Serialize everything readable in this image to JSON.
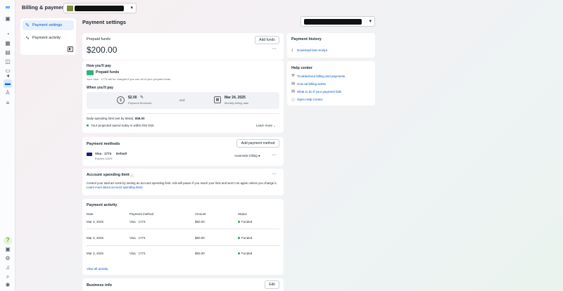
{
  "app": {
    "title": "Billing & payments"
  },
  "rail_icons": [
    "meta-logo-icon",
    "account-icon",
    "dashboard-icon",
    "table-icon",
    "doc-icon",
    "campaign-icon",
    "megaphone-icon",
    "billing-icon",
    "people-icon",
    "menu-icon",
    "help-icon",
    "feedback-icon",
    "settings-icon",
    "notifications-icon",
    "search-icon",
    "bug-icon"
  ],
  "subnav": {
    "items": [
      {
        "label": "Payment settings"
      },
      {
        "label": "Payment activity"
      }
    ]
  },
  "page": {
    "title": "Payment settings"
  },
  "prepaid": {
    "title": "Prepaid funds",
    "amount": "$200.00",
    "add_funds": "Add funds",
    "how_pay_heading": "How you'll pay",
    "method_name": "Prepaid funds",
    "method_note": "Your Visa · 1774 will be charged if you use all of your prepaid funds.",
    "when_pay_heading": "When you'll pay",
    "threshold_value": "$2.00",
    "threshold_label": "Payment threshold",
    "and_text": "and",
    "billing_date": "Mar 24, 2025",
    "billing_label": "Monthly billing date",
    "daily_limit_label": "Daily spending limit (set by Meta):",
    "daily_limit_value": "$58.00",
    "projected_note": "Your projected spend today is within this limit.",
    "learn_more": "Learn more"
  },
  "payment_methods": {
    "title": "Payment methods",
    "add_button": "Add payment method",
    "card_name": "Visa · 1774",
    "default_badge": "Default",
    "expires": "Expires 10/29",
    "auto_billing": "Automatic billing"
  },
  "spending_limit": {
    "title": "Account spending limit",
    "description": "Control your total ad costs by setting an account spending limit. Ads will pause if you reach your limit and won't run again unless you change it.",
    "link": "Learn more about account spending limits"
  },
  "activity": {
    "title": "Payment activity",
    "headers": [
      "Date",
      "Payment method",
      "Amount",
      "Status"
    ],
    "rows": [
      {
        "date": "Mar 3, 2025",
        "method": "Visa · 1774",
        "amount": "$50.00",
        "status": "Funded"
      },
      {
        "date": "Mar 3, 2025",
        "method": "Visa · 1774",
        "amount": "$50.00",
        "status": "Funded"
      },
      {
        "date": "Mar 3, 2025",
        "method": "Visa · 1774",
        "amount": "$50.00",
        "status": "Funded"
      }
    ],
    "view_all": "View all activity"
  },
  "business_info": {
    "title": "Business info",
    "edit": "Edit"
  },
  "history": {
    "title": "Payment history",
    "download": "Download last receipt"
  },
  "help": {
    "title": "Help center",
    "links": [
      "Troubleshoot billing and payments",
      "How ad billing works",
      "What to do if your payment fails",
      "Open Help Center"
    ]
  },
  "colors": {
    "accent": "#0866ff",
    "link": "#0a55c7",
    "funded": "#31a24c",
    "funds_icon": "#2fb37a"
  }
}
